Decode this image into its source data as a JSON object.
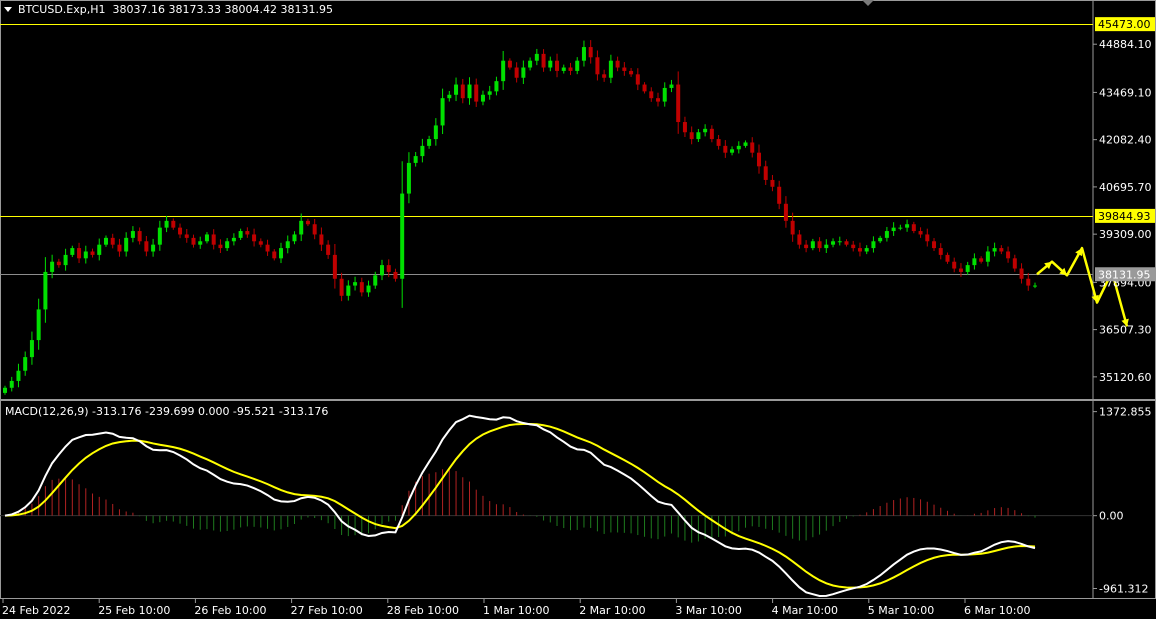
{
  "header": {
    "symbol_line": "BTCUSD.Exp,H1  38037.16 38173.33 38004.42 38131.95",
    "macd_line": "MACD(12,26,9) -313.176 -239.699 0.000 -95.521 -313.176"
  },
  "colors": {
    "background": "#000000",
    "bull": "#00e000",
    "bear": "#c00000",
    "level_line": "#ffff00",
    "price_line": "#8c8c8c",
    "macd_main": "#ffffff",
    "macd_signal": "#ffff00",
    "hist_pos": "#b22222",
    "hist_neg": "#1e7b1e",
    "arrow": "#ffff00"
  },
  "chart_data": [
    {
      "type": "candlestick",
      "symbol": "BTCUSD.Exp",
      "timeframe": "H1",
      "last_ohlc": {
        "open": 38037.16,
        "high": 38173.33,
        "low": 38004.42,
        "close": 38131.95
      },
      "ylim": [
        34500,
        45800
      ],
      "y_ticks": [
        "44884.10",
        "43469.10",
        "42082.40",
        "40695.70",
        "39309.00",
        "37894.00",
        "36507.30",
        "35120.60"
      ],
      "y_tick_values": [
        44884.1,
        43469.1,
        42082.4,
        40695.7,
        39309.0,
        37894.0,
        36507.3,
        35120.6
      ],
      "levels": [
        {
          "label": "45473.00",
          "value": 45473.0
        },
        {
          "label": "39844.93",
          "value": 39844.93
        }
      ],
      "price_line": {
        "label": "38131.95",
        "value": 38131.95
      },
      "x_ticks": [
        "24 Feb 2022",
        "25 Feb 10:00",
        "26 Feb 10:00",
        "27 Feb 10:00",
        "28 Feb 10:00",
        "1 Mar 10:00",
        "2 Mar 10:00",
        "3 Mar 10:00",
        "4 Mar 10:00",
        "5 Mar 10:00",
        "6 Mar 10:00"
      ],
      "closes": [
        34800,
        35000,
        35300,
        35700,
        36200,
        37100,
        38200,
        38500,
        38400,
        38700,
        38900,
        38600,
        38800,
        38700,
        39000,
        39200,
        39000,
        38800,
        39200,
        39400,
        39100,
        38800,
        39000,
        39500,
        39700,
        39500,
        39300,
        39200,
        39000,
        39100,
        39300,
        39000,
        38900,
        39100,
        39200,
        39400,
        39300,
        39100,
        39000,
        38800,
        38600,
        38900,
        39100,
        39300,
        39700,
        39600,
        39300,
        39000,
        38700,
        38000,
        37500,
        37800,
        37900,
        37600,
        37800,
        38100,
        38400,
        38200,
        38000,
        40500,
        41400,
        41600,
        41900,
        42100,
        42500,
        43300,
        43400,
        43700,
        43300,
        43700,
        43200,
        43400,
        43500,
        43800,
        44400,
        44200,
        43900,
        44200,
        44400,
        44600,
        44200,
        44400,
        44100,
        44200,
        44100,
        44400,
        44800,
        44500,
        44000,
        43900,
        44400,
        44200,
        44100,
        44000,
        43700,
        43500,
        43300,
        43200,
        43600,
        43700,
        42600,
        42300,
        42100,
        42300,
        42400,
        42100,
        41900,
        41700,
        41800,
        41900,
        42000,
        41700,
        41300,
        40900,
        40700,
        40200,
        39700,
        39300,
        39000,
        38900,
        39100,
        38900,
        39000,
        39100,
        39100,
        39000,
        38900,
        38800,
        38900,
        39100,
        39200,
        39400,
        39500,
        39500,
        39600,
        39400,
        39300,
        39100,
        38900,
        38700,
        38500,
        38300,
        38200,
        38400,
        38600,
        38500,
        38800,
        38900,
        38800,
        38600,
        38300,
        38000,
        37800,
        37800
      ],
      "projection": [
        38131.95,
        38500,
        38100,
        38900,
        37300,
        38200,
        36600
      ]
    },
    {
      "type": "line",
      "indicator": "MACD(12,26,9)",
      "ylim": [
        -1100,
        1500
      ],
      "y_ticks": [
        "1372.855",
        "0.00",
        "-961.312"
      ],
      "y_tick_values": [
        1372.855,
        0,
        -961.312
      ],
      "series": [
        {
          "name": "main",
          "color": "#ffffff"
        },
        {
          "name": "signal",
          "color": "#ffff00"
        },
        {
          "name": "histogram"
        }
      ]
    }
  ]
}
